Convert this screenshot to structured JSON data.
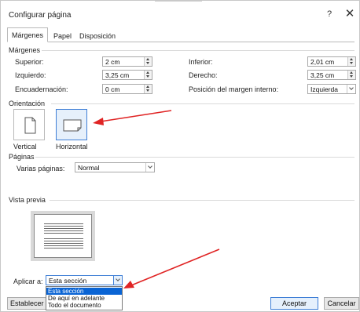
{
  "dialog": {
    "title": "Configurar página",
    "help_label": "?",
    "close_label": "✕"
  },
  "tabs": [
    {
      "label": "Márgenes",
      "active": true
    },
    {
      "label": "Papel",
      "active": false
    },
    {
      "label": "Disposición",
      "active": false
    }
  ],
  "margins": {
    "section_label": "Márgenes",
    "top_label": "Superior:",
    "top_value": "2 cm",
    "bottom_label": "Inferior:",
    "bottom_value": "2,01 cm",
    "left_label": "Izquierdo:",
    "left_value": "3,25 cm",
    "right_label": "Derecho:",
    "right_value": "3,25 cm",
    "gutter_label": "Encuadernación:",
    "gutter_value": "0 cm",
    "gutter_pos_label": "Posición del margen interno:",
    "gutter_pos_value": "Izquierda"
  },
  "orientation": {
    "section_label": "Orientación",
    "portrait_label": "Vertical",
    "landscape_label": "Horizontal",
    "selected": "landscape"
  },
  "pages": {
    "section_label": "Páginas",
    "multiple_label": "Varias páginas:",
    "multiple_value": "Normal"
  },
  "preview": {
    "section_label": "Vista previa"
  },
  "apply": {
    "label": "Aplicar a:",
    "value": "Esta sección",
    "options": [
      "Esta sección",
      "De aquí en adelante",
      "Todo el documento"
    ],
    "highlighted_index": 0
  },
  "footer": {
    "default_label": "Establecer",
    "ok_label": "Aceptar",
    "cancel_label": "Cancelar"
  },
  "colors": {
    "accent": "#0a64d4",
    "annotation_arrow": "#e02424"
  }
}
